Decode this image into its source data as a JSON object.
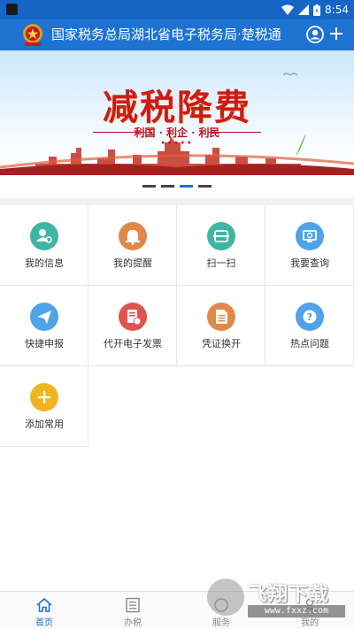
{
  "status_bar": {
    "time": "8:54"
  },
  "header": {
    "title": "国家税务总局湖北省电子税务局·楚税通"
  },
  "banner": {
    "title": "减税降费",
    "subtitle": "利国 · 利企 · 利民",
    "stars": "★★★★★",
    "active_slide": 3,
    "slide_count": 4
  },
  "grid": {
    "items": [
      {
        "label": "我的信息",
        "icon": "user-info-icon",
        "color": "#3fb5a5"
      },
      {
        "label": "我的提醒",
        "icon": "bell-icon",
        "color": "#e0884a"
      },
      {
        "label": "扫一扫",
        "icon": "scan-icon",
        "color": "#3fb5a5"
      },
      {
        "label": "我要查询",
        "icon": "query-icon",
        "color": "#4fa3e6"
      },
      {
        "label": "快捷申报",
        "icon": "send-icon",
        "color": "#4fa3e6"
      },
      {
        "label": "代开电子发票",
        "icon": "invoice-icon",
        "color": "#e0534f"
      },
      {
        "label": "凭证换开",
        "icon": "document-icon",
        "color": "#e0884a"
      },
      {
        "label": "热点问题",
        "icon": "question-icon",
        "color": "#4fa3e6"
      },
      {
        "label": "添加常用",
        "icon": "plus-icon",
        "color": "#f0b51e"
      }
    ]
  },
  "bottom_nav": {
    "items": [
      {
        "label": "首页",
        "icon": "home-icon",
        "active": true
      },
      {
        "label": "办税",
        "icon": "list-icon",
        "active": false
      },
      {
        "label": "服务",
        "icon": "service-icon",
        "active": false
      },
      {
        "label": "我的",
        "icon": "profile-icon",
        "active": false
      }
    ]
  },
  "watermark": {
    "text": "飞翔下载",
    "url": "www.fxxz.com"
  },
  "colors": {
    "primary": "#1e73d2",
    "status_bar": "#1566c7",
    "banner_red": "#cc1b1b"
  }
}
